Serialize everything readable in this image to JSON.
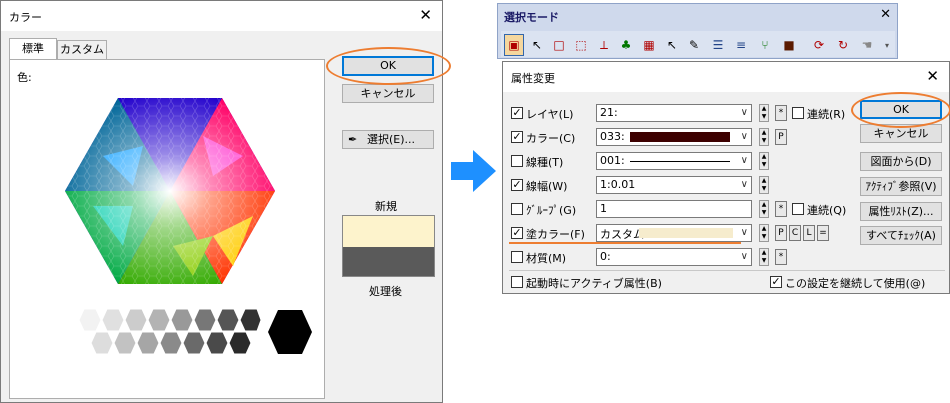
{
  "color_dialog": {
    "title": "カラー",
    "tabs": [
      "標準",
      "カスタム"
    ],
    "color_label": "色:",
    "ok_label": "OK",
    "cancel_label": "キャンセル",
    "select_label": "選択(E)...",
    "new_label": "新規",
    "current_label": "処理後",
    "new_color": "#fdf3cc",
    "current_color": "#5a5a5a"
  },
  "toolbar": {
    "title": "選択モード",
    "icons": [
      "select-mode-icon",
      "pointer-icon",
      "rect-select-icon",
      "dashed-rect-icon",
      "line-select-icon",
      "person-icon",
      "grid-select-icon",
      "pointer-rect-icon",
      "paint-select-icon",
      "lines-icon",
      "thick-lines-icon",
      "branch-icon",
      "block-icon",
      "shape-icon",
      "chart-icon",
      "hand-icon",
      "dropdown-arrow-icon"
    ]
  },
  "attr_dialog": {
    "title": "属性変更",
    "ok_label": "OK",
    "cancel_label": "キャンセル",
    "side_buttons": [
      "図面から(D)",
      "ｱｸﾃｨﾌﾞ参照(V)",
      "属性ﾘｽﾄ(Z)...",
      "すべてﾁｪｯｸ(A)"
    ],
    "rows": [
      {
        "label": "レイヤ(L)",
        "checked": true,
        "value": "21:"
      },
      {
        "label": "カラー(C)",
        "checked": true,
        "value": "033:",
        "swatch": "#3d0000"
      },
      {
        "label": "線種(T)",
        "checked": false,
        "value": "001:"
      },
      {
        "label": "線幅(W)",
        "checked": true,
        "value": "1:0.01"
      },
      {
        "label": "ｸﾞﾙｰﾌﾟ(G)",
        "checked": false,
        "value": "1"
      },
      {
        "label": "塗カラー(F)",
        "checked": true,
        "value": "カスタム",
        "swatch": "#f6eccd"
      },
      {
        "label": "材質(M)",
        "checked": false,
        "value": "0:"
      }
    ],
    "renzoku_r": "連続(R)",
    "renzoku_q": "連続(Q)",
    "star": "*",
    "p_label": "P",
    "c_label": "C",
    "l_label": "L",
    "eq_label": "=",
    "startup_active": "起動時にアクティブ属性(B)",
    "continue_use": "この設定を継続して使用(@)",
    "check_mark": "✓"
  },
  "accent": {
    "highlight": "#ed7d31",
    "arrow": "#1e90ff",
    "toolbar_bg": "#cfd9ec"
  }
}
